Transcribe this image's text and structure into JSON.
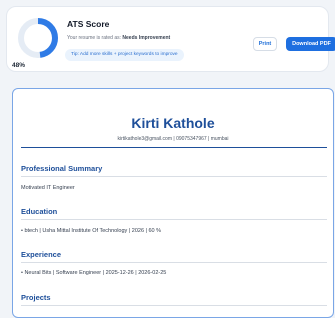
{
  "ats": {
    "title": "ATS Score",
    "score_percent": "48%",
    "score_value": 48,
    "subtitle_prefix": "Your resume is rated as:",
    "rating": "Needs Improvement",
    "tip": "Tip: Add more skills + project keywords to improve",
    "print_label": "Print",
    "download_label": "Download PDF"
  },
  "resume": {
    "name": "Kirti Kathole",
    "contact": "kirtikathole3@gmail.com | 09075347967 | mumbai",
    "sections": {
      "summary": {
        "title": "Professional Summary",
        "text": "Motivated IT Engineer"
      },
      "education": {
        "title": "Education",
        "text": "•  btech | Usha Mittal Institute Of Technology | 2026 | 60 %"
      },
      "experience": {
        "title": "Experience",
        "text": "•  Neural Bits | Software Engineer | 2025-12-26 | 2026-02-25"
      },
      "projects": {
        "title": "Projects"
      }
    }
  },
  "colors": {
    "accent": "#1e6fe0",
    "heading": "#1e4f9a",
    "ring_track": "#e5ecf5",
    "ring_fill": "#2f7be6"
  }
}
